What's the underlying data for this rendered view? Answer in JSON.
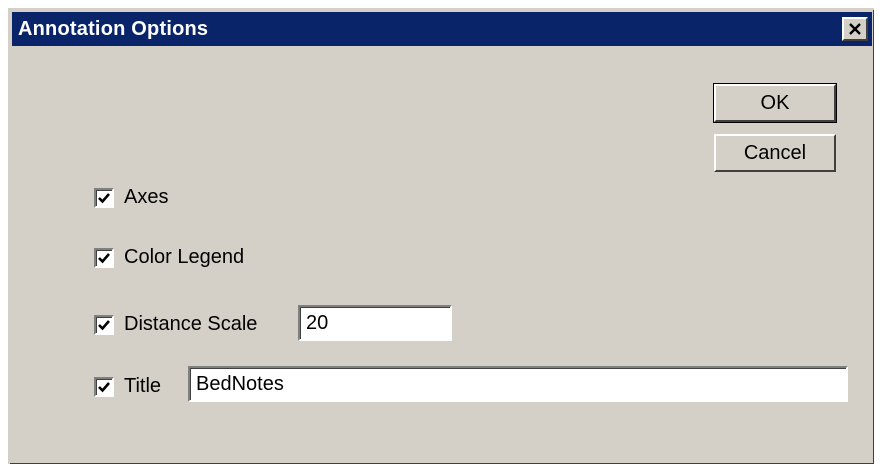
{
  "dialog": {
    "title": "Annotation Options",
    "close_glyph": "✕"
  },
  "buttons": {
    "ok": "OK",
    "cancel": "Cancel"
  },
  "options": {
    "axes": {
      "label": "Axes",
      "checked": true
    },
    "color_legend": {
      "label": "Color Legend",
      "checked": true
    },
    "distance_scale": {
      "label": "Distance Scale",
      "checked": true,
      "value": "20"
    },
    "title": {
      "label": "Title",
      "checked": true,
      "value": "BedNotes"
    }
  },
  "colors": {
    "titlebar": "#0a246a",
    "face": "#d4d0c8"
  }
}
